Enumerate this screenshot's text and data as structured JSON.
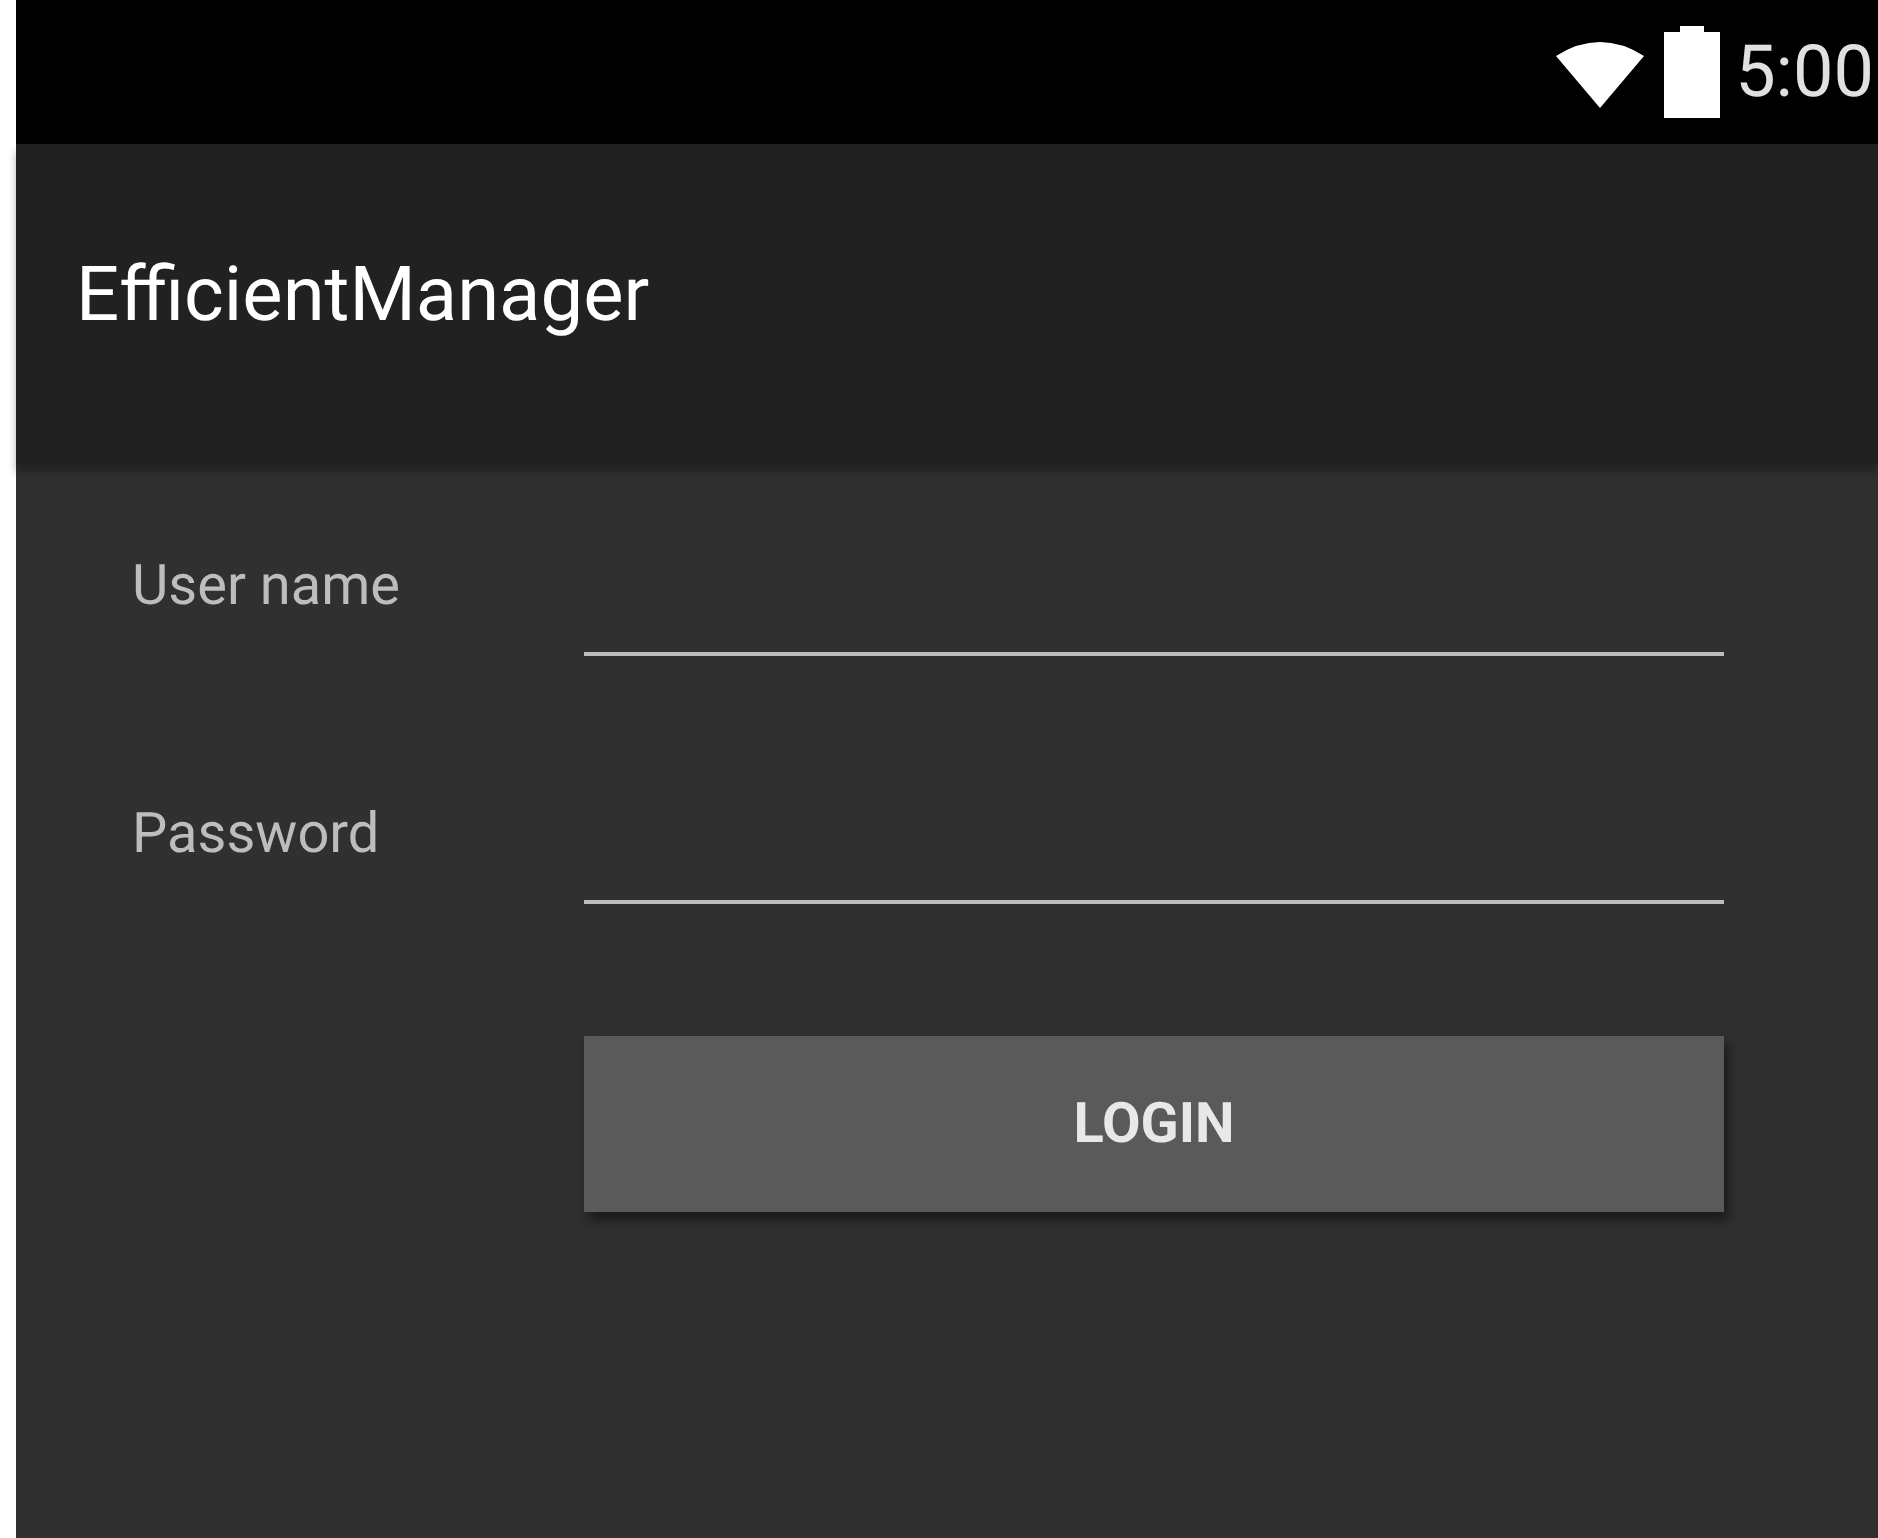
{
  "status_bar": {
    "time": "5:00"
  },
  "app_bar": {
    "title": "EfficientManager"
  },
  "fields": [
    {
      "label": "User name"
    },
    {
      "label": "Password"
    }
  ],
  "button": {
    "label": "LOGIN"
  }
}
